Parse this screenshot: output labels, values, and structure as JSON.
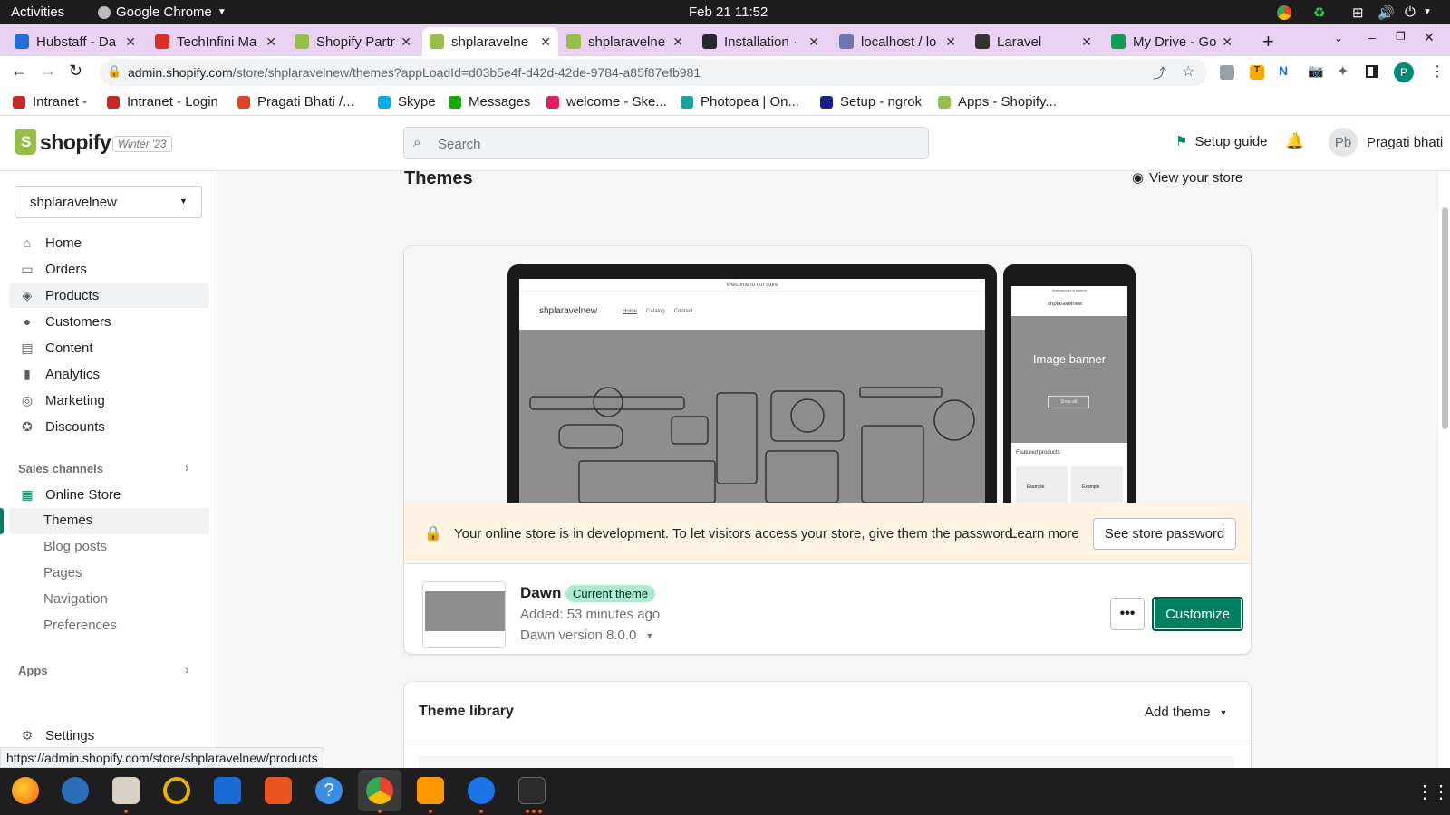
{
  "system_bar": {
    "activities": "Activities",
    "app": "Google Chrome",
    "datetime": "Feb 21  11:52"
  },
  "tabs": [
    {
      "title": "Hubstaff - Da",
      "color": "#1f6fd8"
    },
    {
      "title": "TechInfini Ma",
      "color": "#d93025"
    },
    {
      "title": "Shopify Partn",
      "color": "#95bf47"
    },
    {
      "title": "shplaravelne",
      "color": "#95bf47",
      "active": true
    },
    {
      "title": "shplaravelne",
      "color": "#95bf47"
    },
    {
      "title": "Installation ·",
      "color": "#24292f"
    },
    {
      "title": "localhost / lo",
      "color": "#6c78af"
    },
    {
      "title": "Laravel",
      "color": "#333333"
    },
    {
      "title": "My Drive - Go",
      "color": "#0f9d58"
    }
  ],
  "browser": {
    "url_host": "admin.shopify.com",
    "url_path": "/store/shplaravelnew/themes?appLoadId=d03b5e4f-d42d-42de-9784-a85f87efb981",
    "profile_initial": "P",
    "status_url": "https://admin.shopify.com/store/shplaravelnew/products"
  },
  "bookmarks": [
    {
      "label": "Intranet -",
      "color": "#c62828"
    },
    {
      "label": "Intranet - Login",
      "color": "#c62828"
    },
    {
      "label": "Pragati Bhati /...",
      "color": "#e24329"
    },
    {
      "label": "Skype",
      "color": "#00aff0"
    },
    {
      "label": "Messages",
      "color": "#14a800"
    },
    {
      "label": "welcome - Ske...",
      "color": "#e01e5a"
    },
    {
      "label": "Photopea | On...",
      "color": "#18a497"
    },
    {
      "label": "Setup - ngrok",
      "color": "#1f1e8c"
    },
    {
      "label": "Apps - Shopify...",
      "color": "#95bf47"
    }
  ],
  "shopify": {
    "logo": "shopify",
    "edition": "Winter '23",
    "search_placeholder": "Search",
    "setup_guide": "Setup guide",
    "user_initials": "Pb",
    "user_name": "Pragati bhati",
    "brand_green": "#008060"
  },
  "sidebar": {
    "store": "shplaravelnew",
    "items": [
      "Home",
      "Orders",
      "Products",
      "Customers",
      "Content",
      "Analytics",
      "Marketing",
      "Discounts"
    ],
    "sales_channels": "Sales channels",
    "online_store": "Online Store",
    "sub_items": [
      "Themes",
      "Blog posts",
      "Pages",
      "Navigation",
      "Preferences"
    ],
    "apps": "Apps",
    "settings": "Settings"
  },
  "main": {
    "title": "Themes",
    "view_store": "View your store",
    "preview": {
      "announcement": "Welcome to our store",
      "store_name": "shplaravelnew",
      "nav": [
        "Home",
        "Catalog",
        "Contact"
      ],
      "mobile_banner": "Image banner",
      "mobile_shop": "Shop all",
      "featured": "Featured products",
      "example": "Example"
    },
    "dev_notice": "Your online store is in development. To let visitors access your store, give them the password.",
    "learn_more": "Learn more",
    "see_password": "See store password",
    "theme": {
      "name": "Dawn",
      "badge": "Current theme",
      "added": "Added: 53 minutes ago",
      "version": "Dawn version 8.0.0",
      "customize": "Customize"
    },
    "library": {
      "title": "Theme library",
      "add_theme": "Add theme"
    }
  }
}
